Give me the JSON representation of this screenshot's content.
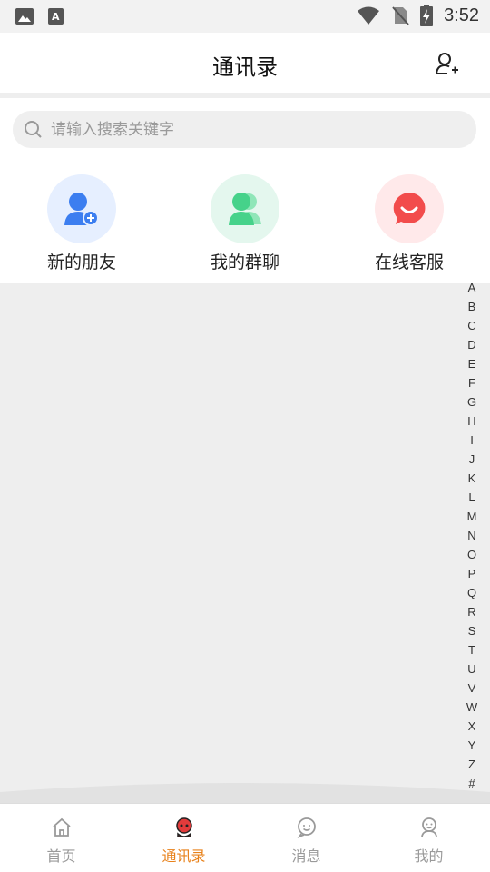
{
  "status_bar": {
    "time": "3:52"
  },
  "header": {
    "title": "通讯录"
  },
  "search": {
    "placeholder": "请输入搜索关键字"
  },
  "quick_actions": [
    {
      "label": "新的朋友",
      "icon": "add-friend-icon",
      "bg": "#e6efff",
      "color": "#3c7ef0"
    },
    {
      "label": "我的群聊",
      "icon": "group-chat-icon",
      "bg": "#e4f7ee",
      "color": "#46d28a"
    },
    {
      "label": "在线客服",
      "icon": "customer-service-icon",
      "bg": "#ffe9ea",
      "color": "#f24c4c"
    }
  ],
  "index_letters": [
    "A",
    "B",
    "C",
    "D",
    "E",
    "F",
    "G",
    "H",
    "I",
    "J",
    "K",
    "L",
    "M",
    "N",
    "O",
    "P",
    "Q",
    "R",
    "S",
    "T",
    "U",
    "V",
    "W",
    "X",
    "Y",
    "Z",
    "#"
  ],
  "tabs": [
    {
      "label": "首页",
      "icon": "home-icon"
    },
    {
      "label": "通讯录",
      "icon": "contacts-icon",
      "active": true
    },
    {
      "label": "消息",
      "icon": "message-icon"
    },
    {
      "label": "我的",
      "icon": "profile-icon"
    }
  ],
  "colors": {
    "accent": "#e8811a"
  }
}
